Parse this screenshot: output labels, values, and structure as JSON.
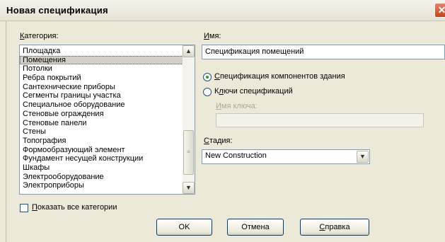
{
  "window": {
    "title": "Новая спецификация",
    "close_glyph": "✕"
  },
  "category": {
    "label_underlined": "К",
    "label_rest": "атегория:",
    "items": [
      "Площадка",
      "Помещения",
      "Потолки",
      "Ребра покрытий",
      "Сантехнические приборы",
      "Сегменты границы участка",
      "Специальное оборудование",
      "Стеновые ограждения",
      "Стеновые панели",
      "Стены",
      "Топография",
      "Формообразующий элемент",
      "Фундамент несущей конструкции",
      "Шкафы",
      "Электрооборудование",
      "Электроприборы"
    ],
    "selected_index": 1,
    "scroll_up_glyph": "▲",
    "scroll_down_glyph": "▼",
    "thumb_grip_glyph": "≡"
  },
  "show_all": {
    "label_underlined": "П",
    "label_rest": "оказать все категории",
    "checked": false
  },
  "name": {
    "label_underlined": "И",
    "label_rest": "мя:",
    "value": "Спецификация помещений"
  },
  "options": {
    "building_components": {
      "label_underlined": "С",
      "label_rest": "пецификация компонентов здания",
      "selected": true
    },
    "schedule_keys": {
      "label_pre": "К",
      "label_underlined": "л",
      "label_rest": "ючи спецификаций",
      "selected": false
    },
    "key_name": {
      "label_underlined": "И",
      "label_rest": "мя ключа:",
      "value": ""
    }
  },
  "phase": {
    "label_underlined": "С",
    "label_rest": "тадия:",
    "value": "New Construction",
    "dropdown_glyph": "▼"
  },
  "buttons": {
    "ok": "OK",
    "cancel": "Отмена",
    "help_underlined": "С",
    "help_rest": "правка"
  },
  "colors": {
    "dialog_bg": "#ece9d8",
    "selection_bg": "#d4d0c8",
    "border_blue": "#7f9db9",
    "close_red": "#c2451f",
    "radio_dot": "#21a121"
  },
  "icons": {
    "close": "close-icon",
    "scroll_up": "scroll-up-icon",
    "scroll_down": "scroll-down-icon",
    "dropdown": "chevron-down-icon"
  }
}
